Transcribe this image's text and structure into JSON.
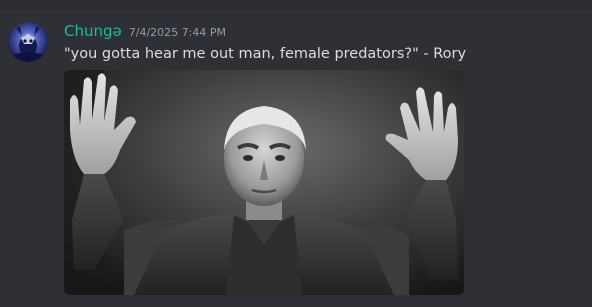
{
  "message": {
    "author": {
      "name": "Chungə",
      "name_color": "#1abc9c"
    },
    "timestamp": "7/4/2025 7:44 PM",
    "content": "\"you gotta hear me out man, female predators?\" - Rory",
    "attachment": {
      "type": "image",
      "description_icon": "photo-icon"
    }
  },
  "colors": {
    "background": "#313338",
    "message_text": "#dbdee1",
    "timestamp": "#949ba4"
  }
}
